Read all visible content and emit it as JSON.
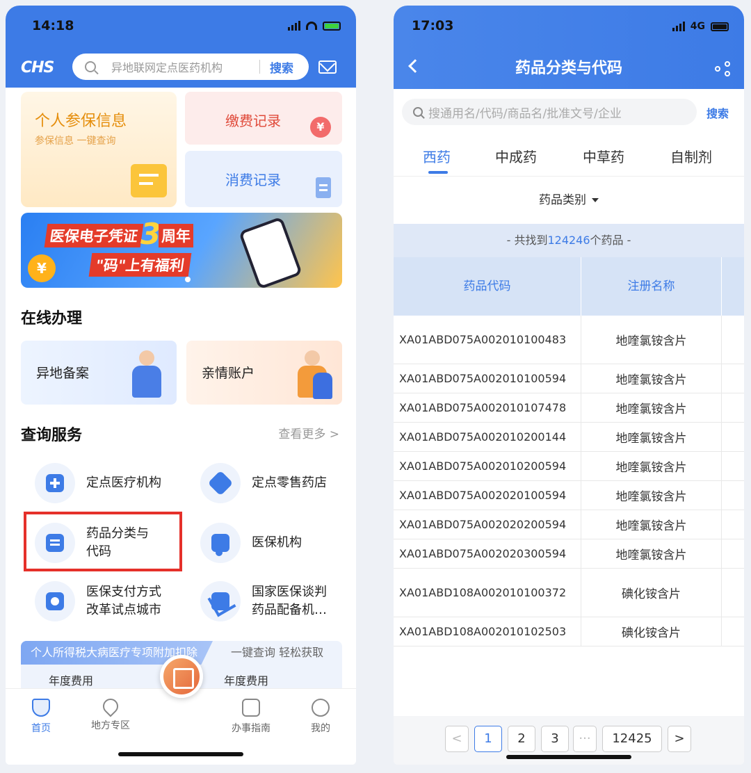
{
  "left": {
    "status_time": "14:18",
    "logo": "CHS",
    "search_placeholder": "异地联网定点医药机构",
    "search_button": "搜索",
    "personal_title": "个人参保信息",
    "personal_sub": "参保信息 一键查询",
    "pay_record": "缴费记录",
    "consume_record": "消费记录",
    "banner": {
      "line1": "医保电子凭证",
      "num": "3",
      "suffix": "周年",
      "line2": "\"码\"上有福利"
    },
    "online_title": "在线办理",
    "online_cards": [
      {
        "label": "异地备案"
      },
      {
        "label": "亲情账户"
      }
    ],
    "query_title": "查询服务",
    "see_more": "查看更多 >",
    "services": [
      {
        "label": "定点医疗机构",
        "icon": "hospital-icon"
      },
      {
        "label": "定点零售药店",
        "icon": "pill-icon"
      },
      {
        "label": "药品分类与\n代码",
        "icon": "document-icon",
        "highlighted": true
      },
      {
        "label": "医保机构",
        "icon": "org-icon"
      },
      {
        "label": "医保支付方式\n改革试点城市",
        "icon": "monitor-icon"
      },
      {
        "label": "国家医保谈判\n药品配备机…",
        "icon": "network-icon"
      }
    ],
    "tax_tag": "个人所得税大病医疗专项附加扣除",
    "tax_sub": "一键查询 轻松获取",
    "tax_cut1": "年度费用",
    "tax_cut2": "年度费用",
    "tabs": [
      {
        "label": "首页",
        "icon": "home-shield-icon"
      },
      {
        "label": "地方专区",
        "icon": "location-icon"
      },
      {
        "label": "办事指南",
        "icon": "guide-icon"
      },
      {
        "label": "我的",
        "icon": "profile-icon"
      }
    ]
  },
  "right": {
    "status_time": "17:03",
    "network": "4G",
    "title": "药品分类与代码",
    "search_placeholder": "搜通用名/代码/商品名/批准文号/企业",
    "search_button": "搜索",
    "tabs": [
      "西药",
      "中成药",
      "中草药",
      "自制剂"
    ],
    "active_tab": 0,
    "category": "药品类别",
    "count_prefix": "- 共找到",
    "count_num": "124246",
    "count_suffix": "个药品 -",
    "columns": [
      "药品代码",
      "注册名称"
    ],
    "rows": [
      {
        "code": "XA01ABD075A002010100483",
        "name": "地喹氯铵含片"
      },
      {
        "code": "XA01ABD075A002010100594",
        "name": "地喹氯铵含片"
      },
      {
        "code": "XA01ABD075A002010107478",
        "name": "地喹氯铵含片"
      },
      {
        "code": "XA01ABD075A002010200144",
        "name": "地喹氯铵含片"
      },
      {
        "code": "XA01ABD075A002010200594",
        "name": "地喹氯铵含片"
      },
      {
        "code": "XA01ABD075A002020100594",
        "name": "地喹氯铵含片"
      },
      {
        "code": "XA01ABD075A002020200594",
        "name": "地喹氯铵含片"
      },
      {
        "code": "XA01ABD075A002020300594",
        "name": "地喹氯铵含片"
      },
      {
        "code": "XA01ABD108A002010100372",
        "name": "碘化铵含片"
      },
      {
        "code": "XA01ABD108A002010102503",
        "name": "碘化铵含片"
      }
    ],
    "pager": {
      "prev": "<",
      "pages": [
        "1",
        "2",
        "3",
        "···",
        "12425"
      ],
      "next": ">",
      "current": "1"
    }
  }
}
